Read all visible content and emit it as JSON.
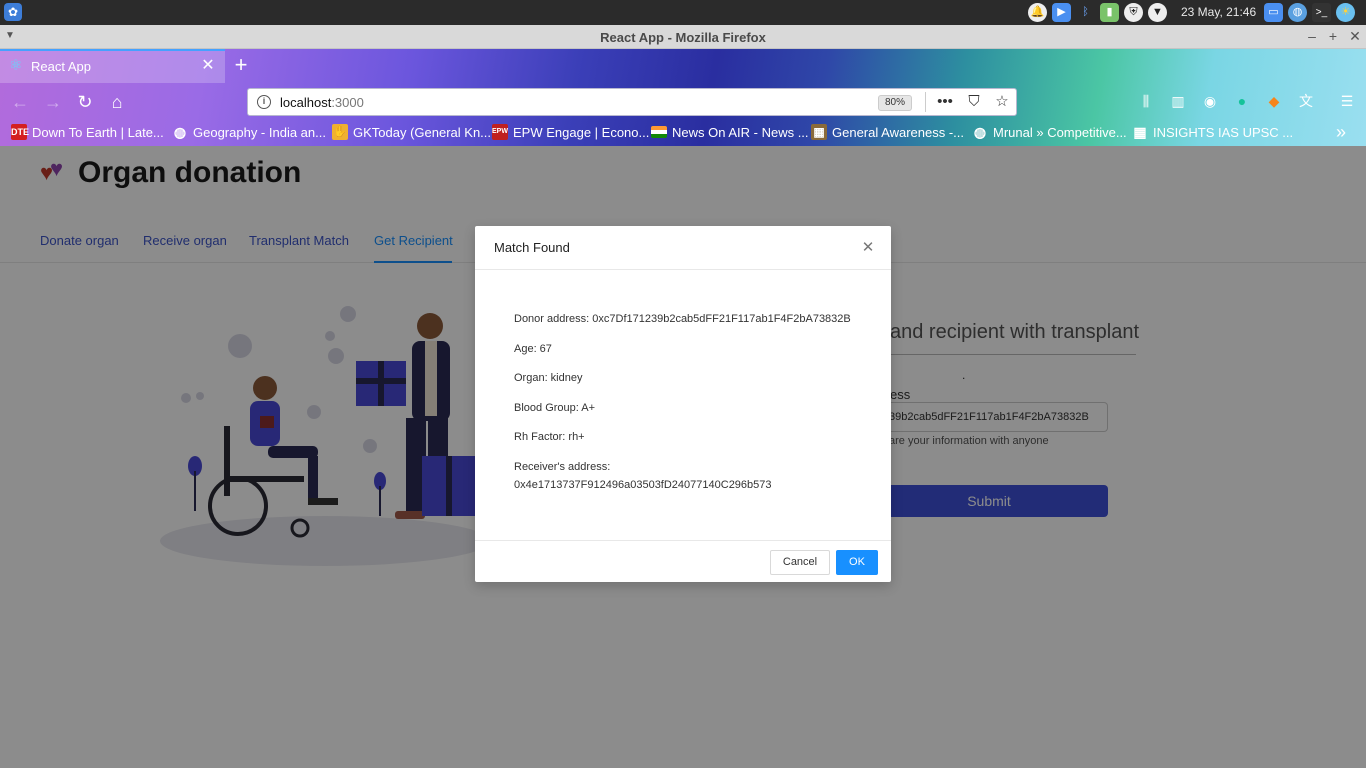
{
  "os": {
    "clock": "23 May, 21:46",
    "tray_icons": [
      "bell-icon",
      "video-icon",
      "bluetooth-icon",
      "network-icon",
      "shield-icon",
      "vpn-icon"
    ],
    "right_icons": [
      "window-icon",
      "globe-icon",
      "terminal-icon",
      "weather-icon"
    ]
  },
  "window": {
    "title": "React App - Mozilla Firefox"
  },
  "browser": {
    "tab_title": "React App",
    "url_host": "localhost",
    "url_port": ":3000",
    "zoom": "80%",
    "bookmarks": [
      {
        "icon": "DTE",
        "label": "Down To Earth | Late...",
        "color": "#d42020"
      },
      {
        "icon": "◍",
        "label": "Geography - India an...",
        "color": "transparent"
      },
      {
        "icon": "✋",
        "label": "GKToday (General Kn...",
        "color": "#f0b030"
      },
      {
        "icon": "EPW",
        "label": "EPW Engage | Econo...",
        "color": "#c02020"
      },
      {
        "icon": "",
        "label": "News On AIR - News ...",
        "color": "flag"
      },
      {
        "icon": "▦",
        "label": "General Awareness -...",
        "color": "#8a6a3a"
      },
      {
        "icon": "◍",
        "label": "Mrunal » Competitive...",
        "color": "transparent"
      },
      {
        "icon": "▦",
        "label": "INSIGHTS IAS UPSC ...",
        "color": "transparent"
      }
    ]
  },
  "page": {
    "title": "Organ donation",
    "nav": [
      "Donate organ",
      "Receive organ",
      "Transplant Match",
      "Get Recipient"
    ],
    "active_nav": "Get Recipient",
    "form": {
      "title": "and recipient with transplant",
      "dot": ".",
      "label": "ess",
      "input_value": "39b2cab5dFF21F117ab1F4F2bA73832B",
      "help": "are your information with anyone",
      "submit": "Submit"
    }
  },
  "modal": {
    "title": "Match Found",
    "close_glyph": "✕",
    "lines": [
      "Donor address: 0xc7Df171239b2cab5dFF21F117ab1F4F2bA73832B",
      "Age: 67",
      "Organ: kidney",
      "Blood Group: A+",
      "Rh Factor: rh+",
      "Receiver's address:",
      "0x4e1713737F912496a03503fD24077140C296b573"
    ],
    "cancel_label": "Cancel",
    "ok_label": "OK"
  }
}
